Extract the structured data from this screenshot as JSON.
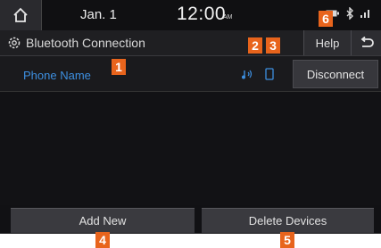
{
  "status_bar": {
    "date": "Jan. 1",
    "time": "12:00",
    "ampm": "AM"
  },
  "header": {
    "title": "Bluetooth Connection",
    "help_label": "Help"
  },
  "device": {
    "name": "Phone Name",
    "disconnect_label": "Disconnect"
  },
  "footer": {
    "add_new_label": "Add New",
    "delete_devices_label": "Delete Devices"
  },
  "callouts": {
    "c1": "1",
    "c2": "2",
    "c3": "3",
    "c4": "4",
    "c5": "5",
    "c6": "6"
  },
  "colors": {
    "callout": "#e8641c",
    "device_name": "#3d8fe0",
    "background": "#111114"
  },
  "icons": {
    "home": "home-icon",
    "gear": "gear-icon",
    "back": "back-icon",
    "music": "bluetooth-audio-icon",
    "phone": "phone-icon"
  }
}
